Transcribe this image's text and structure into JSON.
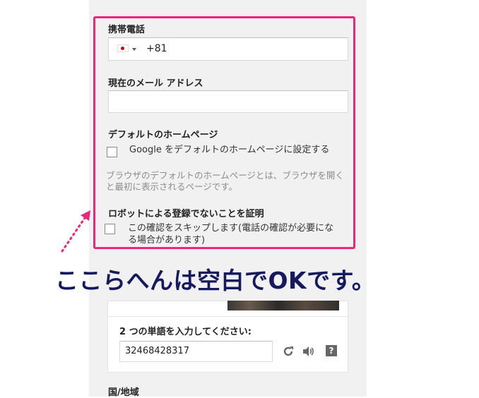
{
  "mobile_phone": {
    "label": "携帯電話",
    "country_code": "+81"
  },
  "email": {
    "label": "現在のメール アドレス",
    "value": ""
  },
  "homepage": {
    "label": "デフォルトのホームページ",
    "checkbox_label": "Google をデフォルトのホームページに設定する",
    "helper_line1": "ブラウザのデフォルトのホームページとは、ブラウザを開く",
    "helper_line2": "と最初に表示されるページです。"
  },
  "robot": {
    "label": "ロボットによる登録でないことを証明",
    "checkbox_line1": "この確認をスキップします(電話の確認が必要にな",
    "checkbox_line2": "る場合があります)"
  },
  "annotation": {
    "text": "ここらへんは空白でOKです。",
    "color": "#15195f"
  },
  "highlight_color": "#e8277d",
  "captcha": {
    "prompt": "2 つの単語を入力してください:",
    "value": "32468428317",
    "refresh_icon": "refresh-icon",
    "audio_icon": "speaker-icon",
    "help_icon": "help-icon",
    "help_glyph": "?"
  },
  "country": {
    "label": "国/地域"
  }
}
